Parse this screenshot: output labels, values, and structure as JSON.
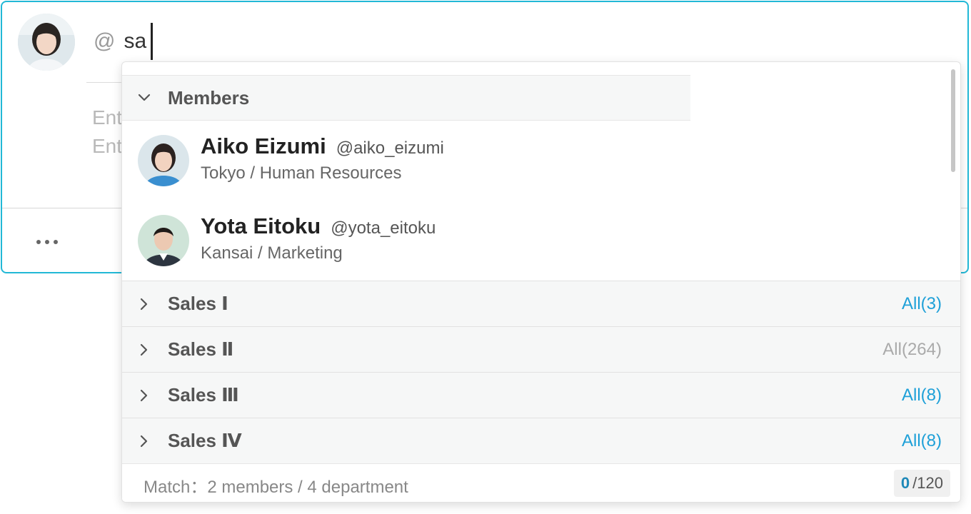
{
  "composer": {
    "mention_at": "@",
    "mention_query": "sa",
    "placeholder_line1": "Ent",
    "placeholder_line2": "Ent",
    "more_icon": "ellipsis-icon",
    "accent_color": "#22b8d6"
  },
  "dropdown": {
    "members_group": {
      "label": "Members",
      "icon": "chevron-down-icon"
    },
    "members": [
      {
        "name": "Aiko Eizumi",
        "handle": "@aiko_eizumi",
        "department": "Tokyo / Human Resources"
      },
      {
        "name": "Yota Eitoku",
        "handle": "@yota_eitoku",
        "department": "Kansai / Marketing"
      }
    ],
    "departments": [
      {
        "label": "Sales Ⅰ",
        "count_label": "All(3)",
        "enabled": true
      },
      {
        "label": "Sales Ⅱ",
        "count_label": "All(264)",
        "enabled": false
      },
      {
        "label": "Sales Ⅲ",
        "count_label": "All(8)",
        "enabled": true
      },
      {
        "label": "Sales Ⅳ",
        "count_label": "All(8)",
        "enabled": true
      }
    ],
    "footer": {
      "match_text": "Match：2 members / 4 department",
      "counter_current": "0",
      "counter_max": "/120"
    },
    "link_color": "#1ea0d8"
  }
}
